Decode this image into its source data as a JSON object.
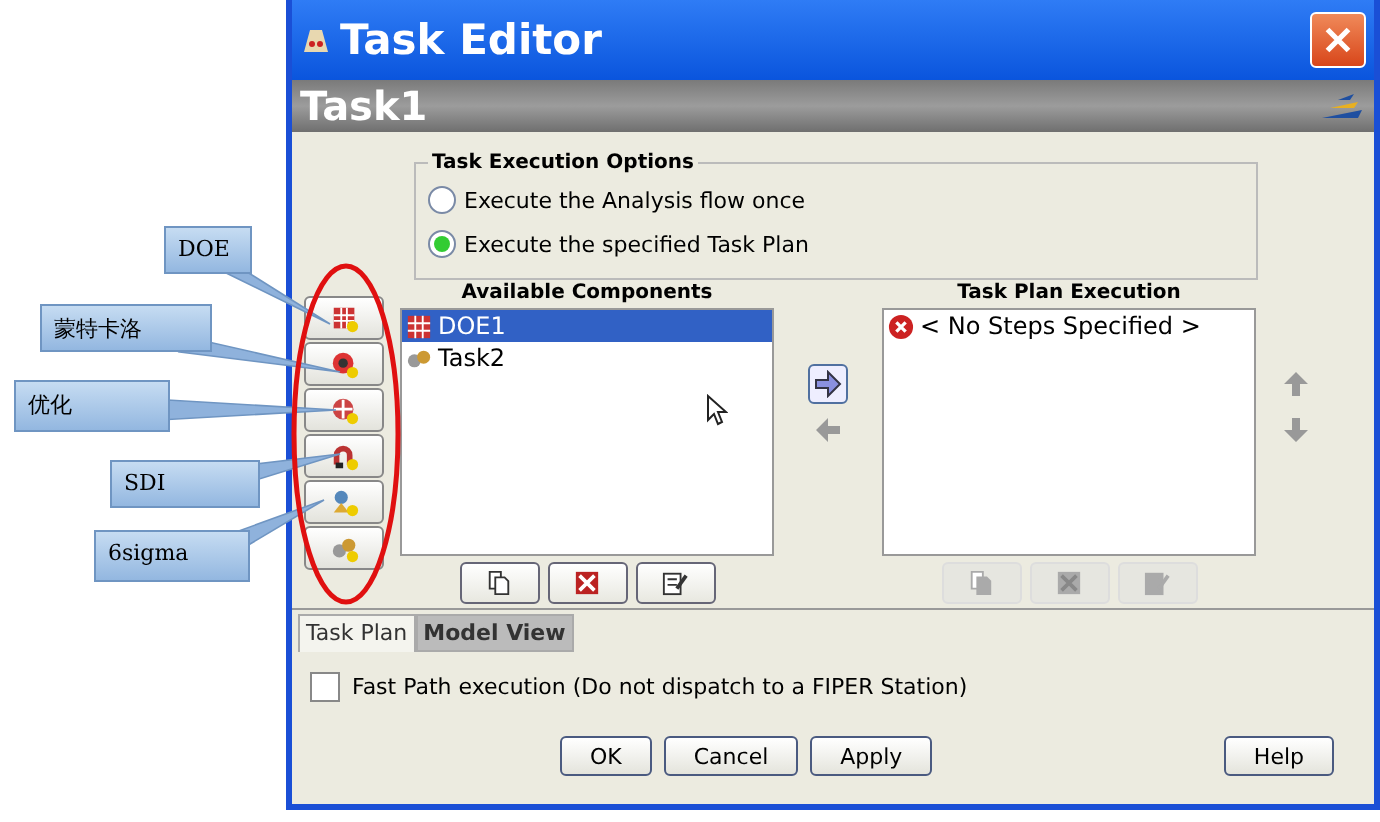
{
  "window": {
    "title": "Task Editor"
  },
  "header": {
    "title": "Task1"
  },
  "options": {
    "title": "Task Execution Options",
    "radios": [
      {
        "label": "Execute the Analysis flow once",
        "selected": false
      },
      {
        "label": "Execute the specified Task Plan",
        "selected": true
      }
    ]
  },
  "tool_buttons": [
    {
      "kind": "doe"
    },
    {
      "kind": "montecarlo"
    },
    {
      "kind": "optimize"
    },
    {
      "kind": "sdi"
    },
    {
      "kind": "sigma"
    },
    {
      "kind": "task"
    }
  ],
  "available": {
    "title": "Available Components",
    "items": [
      {
        "label": "DOE1",
        "kind": "doe",
        "selected": true
      },
      {
        "label": "Task2",
        "kind": "task",
        "selected": false
      }
    ]
  },
  "plan": {
    "title": "Task Plan Execution",
    "items": [
      {
        "label": "< No Steps Specified >",
        "kind": "error"
      }
    ]
  },
  "available_actions": [
    {
      "kind": "copy",
      "disabled": false
    },
    {
      "kind": "delete",
      "disabled": false
    },
    {
      "kind": "edit",
      "disabled": false
    }
  ],
  "plan_actions": [
    {
      "kind": "copy",
      "disabled": true
    },
    {
      "kind": "delete",
      "disabled": true
    },
    {
      "kind": "edit",
      "disabled": true
    }
  ],
  "tabs": [
    {
      "label": "Task Plan",
      "selected": true
    },
    {
      "label": "Model View",
      "selected": false
    }
  ],
  "fast_path": {
    "label": "Fast Path execution (Do not dispatch to a FIPER Station)",
    "checked": false
  },
  "buttons": [
    "OK",
    "Cancel",
    "Apply",
    "Help"
  ],
  "callouts": [
    {
      "text": "DOE"
    },
    {
      "text": "蒙特卡洛"
    },
    {
      "text": "优化"
    },
    {
      "text": "SDI"
    },
    {
      "text": "6sigma"
    }
  ]
}
